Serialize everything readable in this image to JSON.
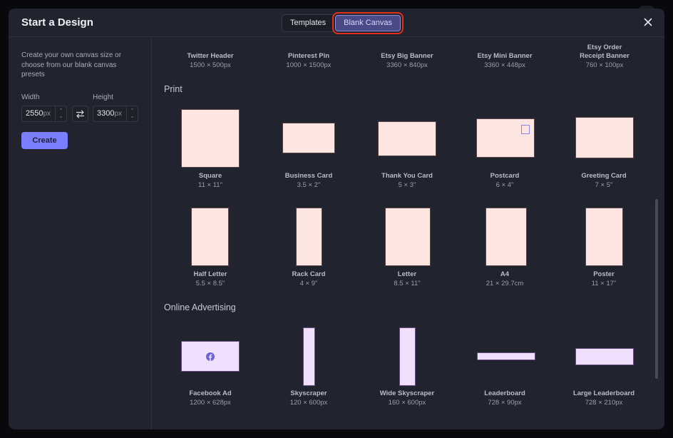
{
  "modal": {
    "title": "Start a Design",
    "tabs": [
      {
        "label": "Templates",
        "active": false
      },
      {
        "label": "Blank Canvas",
        "active": true
      }
    ],
    "close_icon": "close-icon"
  },
  "sidebar": {
    "description": "Create your own canvas size or choose from our blank canvas presets",
    "width_label": "Width",
    "width_value": "2550",
    "width_unit": "px",
    "height_label": "Height",
    "height_value": "3300",
    "height_unit": "px",
    "swap_icon": "swap-arrows-icon",
    "create_label": "Create"
  },
  "social_partial": [
    {
      "name": "Twitter Header",
      "size": "1500 × 500px"
    },
    {
      "name": "Pinterest Pin",
      "size": "1000 × 1500px"
    },
    {
      "name": "Etsy Big Banner",
      "size": "3360 × 840px"
    },
    {
      "name": "Etsy Mini Banner",
      "size": "3360 × 448px"
    },
    {
      "name": "Etsy Order Receipt Banner",
      "size": "760 × 100px"
    }
  ],
  "sections": {
    "print": {
      "title": "Print",
      "items": [
        {
          "name": "Square",
          "size": "11 × 11\""
        },
        {
          "name": "Business Card",
          "size": "3.5 × 2\""
        },
        {
          "name": "Thank You Card",
          "size": "5 × 3\""
        },
        {
          "name": "Postcard",
          "size": "6 × 4\""
        },
        {
          "name": "Greeting Card",
          "size": "7 × 5\""
        },
        {
          "name": "Half Letter",
          "size": "5.5 × 8.5\""
        },
        {
          "name": "Rack Card",
          "size": "4 × 9\""
        },
        {
          "name": "Letter",
          "size": "8.5 × 11\""
        },
        {
          "name": "A4",
          "size": "21 × 29.7cm"
        },
        {
          "name": "Poster",
          "size": "11 × 17\""
        }
      ]
    },
    "online_advertising": {
      "title": "Online Advertising",
      "items": [
        {
          "name": "Facebook Ad",
          "size": "1200 × 628px",
          "icon": "facebook-icon"
        },
        {
          "name": "Skyscraper",
          "size": "120 × 600px"
        },
        {
          "name": "Wide Skyscraper",
          "size": "160 × 600px"
        },
        {
          "name": "Leaderboard",
          "size": "728 × 90px"
        },
        {
          "name": "Large Leaderboard",
          "size": "728 × 210px"
        }
      ]
    }
  },
  "colors": {
    "accent": "#7b7fff",
    "print_thumb": "#fde6e1",
    "ad_thumb": "#f1e0fd",
    "highlight": "#e0301e"
  }
}
